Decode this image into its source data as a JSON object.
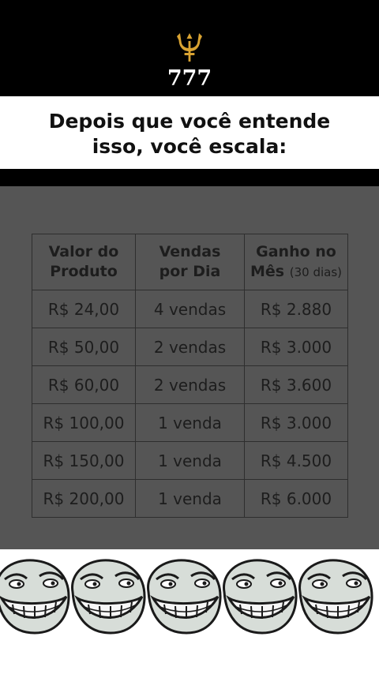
{
  "header": {
    "brand": "777",
    "icon": "trident-icon",
    "icon_color": "#d9a332"
  },
  "caption": {
    "line1": "Depois que você entende",
    "line2": "isso, você escala:"
  },
  "table": {
    "headers": [
      {
        "line1": "Valor do",
        "line2": "Produto",
        "suffix": ""
      },
      {
        "line1": "Vendas",
        "line2": "por Dia",
        "suffix": ""
      },
      {
        "line1": "Ganho no",
        "line2": "Mês",
        "suffix": "(30 dias)"
      }
    ],
    "rows": [
      {
        "valor": "R$ 24,00",
        "vendas": "4 vendas",
        "ganho": "R$ 2.880"
      },
      {
        "valor": "R$ 50,00",
        "vendas": "2 vendas",
        "ganho": "R$ 3.000"
      },
      {
        "valor": "R$ 60,00",
        "vendas": "2 vendas",
        "ganho": "R$ 3.600"
      },
      {
        "valor": "R$ 100,00",
        "vendas": "1 venda",
        "ganho": "R$ 3.000"
      },
      {
        "valor": "R$ 150,00",
        "vendas": "1 venda",
        "ganho": "R$ 4.500"
      },
      {
        "valor": "R$ 200,00",
        "vendas": "1 venda",
        "ganho": "R$ 6.000"
      }
    ]
  },
  "decor": {
    "face_icon": "troll-face-icon",
    "face_count": 5
  }
}
